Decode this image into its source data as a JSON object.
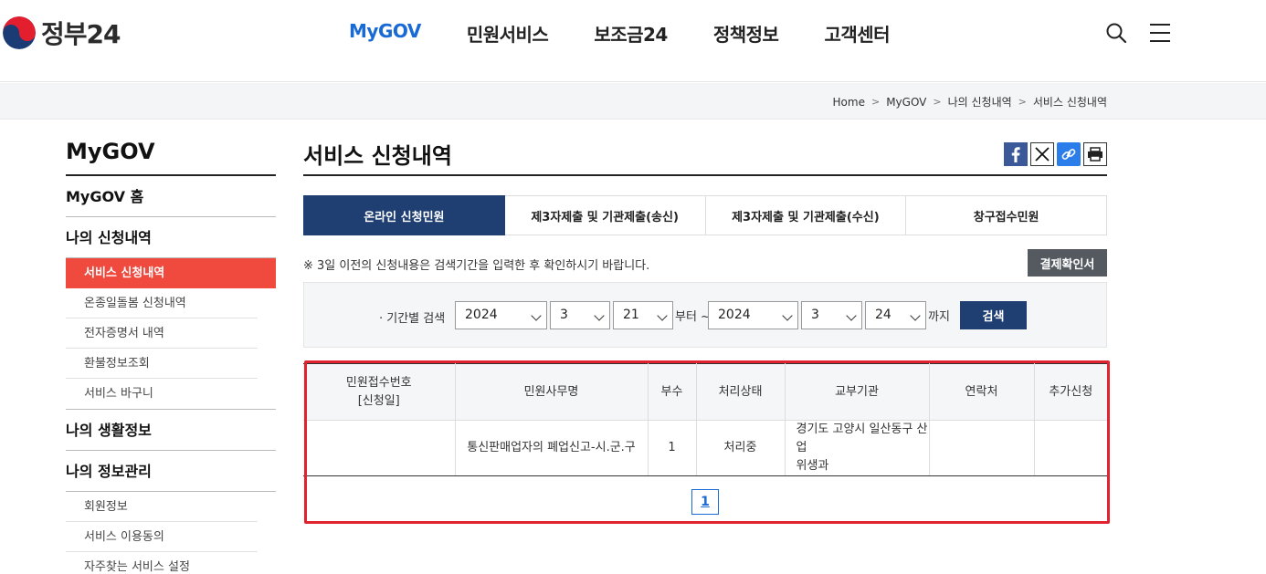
{
  "header": {
    "logo_text": "정부24",
    "nav": [
      "MyGOV",
      "민원서비스",
      "보조금24",
      "정책정보",
      "고객센터"
    ],
    "accent": "#1a6ad6"
  },
  "breadcrumb": [
    "Home",
    "MyGOV",
    "나의 신청내역",
    "서비스 신청내역"
  ],
  "sidebar": {
    "title": "MyGOV",
    "home": "MyGOV 홈",
    "sec1": "나의 신청내역",
    "sec1_items": [
      "서비스 신청내역",
      "온종일돌봄 신청내역",
      "전자증명서 내역",
      "환불정보조회",
      "서비스 바구니"
    ],
    "sec2": "나의 생활정보",
    "sec3": "나의 정보관리",
    "sec3_items": [
      "회원정보",
      "서비스 이용동의",
      "자주찾는 서비스 설정"
    ]
  },
  "main": {
    "title": "서비스 신청내역",
    "tabs": [
      "온라인 신청민원",
      "제3자제출 및 기관제출(송신)",
      "제3자제출 및 기관제출(수신)",
      "창구접수민원"
    ],
    "notice": "※ 3일 이전의 신청내용은 검색기간을 입력한 후 확인하시기 바랍니다.",
    "receipt_button": "결제확인서",
    "search": {
      "label": "· 기간별 검색",
      "from_year": "2024",
      "from_month": "3",
      "from_day": "21",
      "from_suffix": "부터 ~",
      "to_year": "2024",
      "to_month": "3",
      "to_day": "24",
      "to_suffix": "까지",
      "button": "검색"
    },
    "table": {
      "headers": [
        "민원접수번호",
        "[신청일]",
        "민원사무명",
        "부수",
        "처리상태",
        "교부기관",
        "연락처",
        "추가신청"
      ],
      "row": {
        "receipt_no": "",
        "name": "통신판매업자의 폐업신고-시.군.구",
        "copies": "1",
        "status": "처리중",
        "agency_line1": "경기도 고양시 일산동구 산업",
        "agency_line2": "위생과",
        "contact": "",
        "extra": ""
      }
    },
    "page": "1"
  }
}
